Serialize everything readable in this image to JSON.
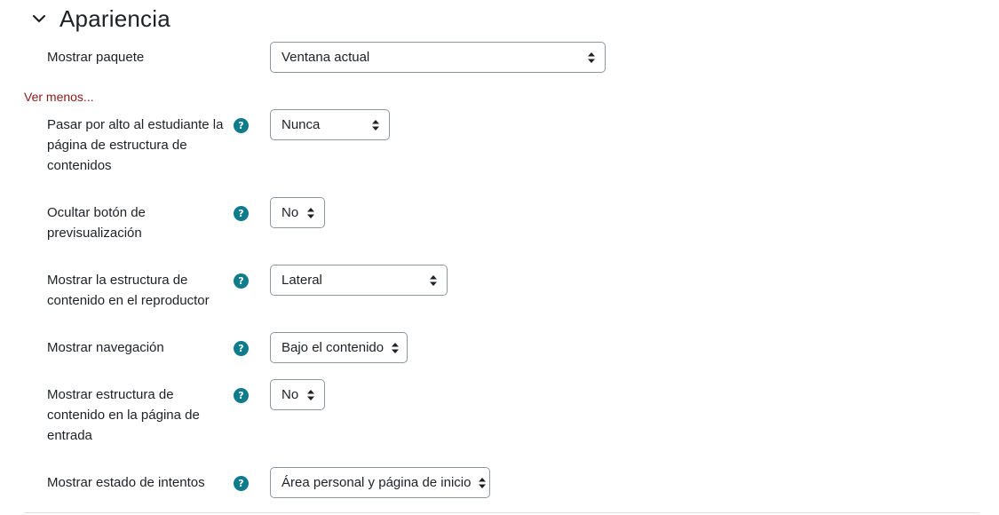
{
  "section": {
    "title": "Apariencia",
    "icon": "chevron-down-icon"
  },
  "show_less_label": "Ver menos...",
  "colors": {
    "help_icon": "#0f7c8c",
    "link": "#8b1a1a",
    "text": "#1d2125",
    "border": "#8f959e"
  },
  "rows": [
    {
      "label": "Mostrar paquete",
      "value": "Ventana actual",
      "has_help": false
    },
    {
      "label": "Pasar por alto al estudiante la página de estructura de contenidos",
      "value": "Nunca",
      "has_help": true
    },
    {
      "label": "Ocultar botón de previsualización",
      "value": "No",
      "has_help": true
    },
    {
      "label": "Mostrar la estructura de contenido en el reproductor",
      "value": "Lateral",
      "has_help": true
    },
    {
      "label": "Mostrar navegación",
      "value": "Bajo el contenido",
      "has_help": true
    },
    {
      "label": "Mostrar estructura de contenido en la página de entrada",
      "value": "No",
      "has_help": true
    },
    {
      "label": "Mostrar estado de intentos",
      "value": "Área personal y página de inicio",
      "has_help": true
    }
  ]
}
